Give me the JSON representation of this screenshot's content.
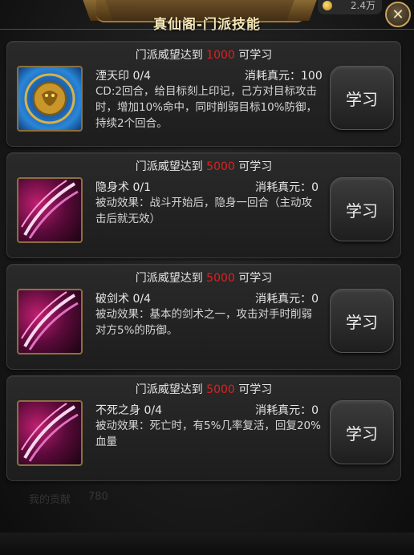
{
  "header": {
    "title": "真仙阁-门派技能",
    "currency_text": "2.4万"
  },
  "background": {
    "contribution_label": "我的贡献",
    "contribution_value": "780"
  },
  "skills": [
    {
      "req_prefix": "门派威望达到",
      "req_value": "1000",
      "req_suffix": "可学习",
      "name": "湮天印 0/4",
      "cost": "消耗真元：100",
      "desc": "CD:2回合，给目标刻上印记，己方对目标攻击时，增加10%命中，同时削弱目标10%防御，持续2个回合。",
      "button": "学习",
      "icon": "lion-seal-icon"
    },
    {
      "req_prefix": "门派威望达到",
      "req_value": "5000",
      "req_suffix": "可学习",
      "name": "隐身术 0/1",
      "cost": "消耗真元：0",
      "desc": "被动效果：战斗开始后，隐身一回合（主动攻击后就无效）",
      "button": "学习",
      "icon": "claw-slash-icon"
    },
    {
      "req_prefix": "门派威望达到",
      "req_value": "5000",
      "req_suffix": "可学习",
      "name": "破剑术 0/4",
      "cost": "消耗真元：0",
      "desc": "被动效果：基本的剑术之一，攻击对手时削弱对方5%的防御。",
      "button": "学习",
      "icon": "claw-slash-icon"
    },
    {
      "req_prefix": "门派威望达到",
      "req_value": "5000",
      "req_suffix": "可学习",
      "name": "不死之身 0/4",
      "cost": "消耗真元：0",
      "desc": "被动效果：死亡时，有5%几率复活，回复20%血量",
      "button": "学习",
      "icon": "claw-slash-icon"
    }
  ],
  "colors": {
    "requirement_number": "#e02020",
    "title_gold": "#f5e6b6"
  }
}
